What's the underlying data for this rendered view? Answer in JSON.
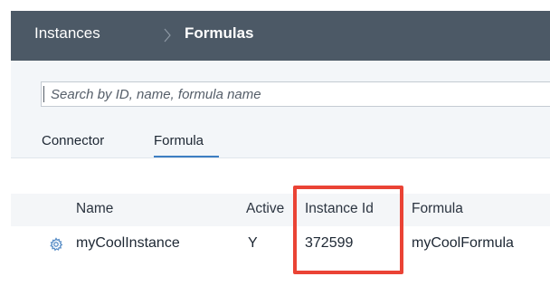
{
  "breadcrumb": {
    "root": "Instances",
    "current": "Formulas"
  },
  "search": {
    "placeholder": "Search by ID, name, formula name",
    "value": ""
  },
  "tabs": [
    {
      "label": "Connector",
      "active": false
    },
    {
      "label": "Formula",
      "active": true
    }
  ],
  "table": {
    "columns": [
      "Name",
      "Active",
      "Instance Id",
      "Formula"
    ],
    "rows": [
      {
        "name": "myCoolInstance",
        "active": "Y",
        "instance_id": "372599",
        "formula": "myCoolFormula",
        "row_icon": "gear-icon"
      }
    ]
  },
  "colors": {
    "topbar": "#4c5966",
    "accent": "#3d7ec2",
    "highlight": "#ea4335"
  }
}
